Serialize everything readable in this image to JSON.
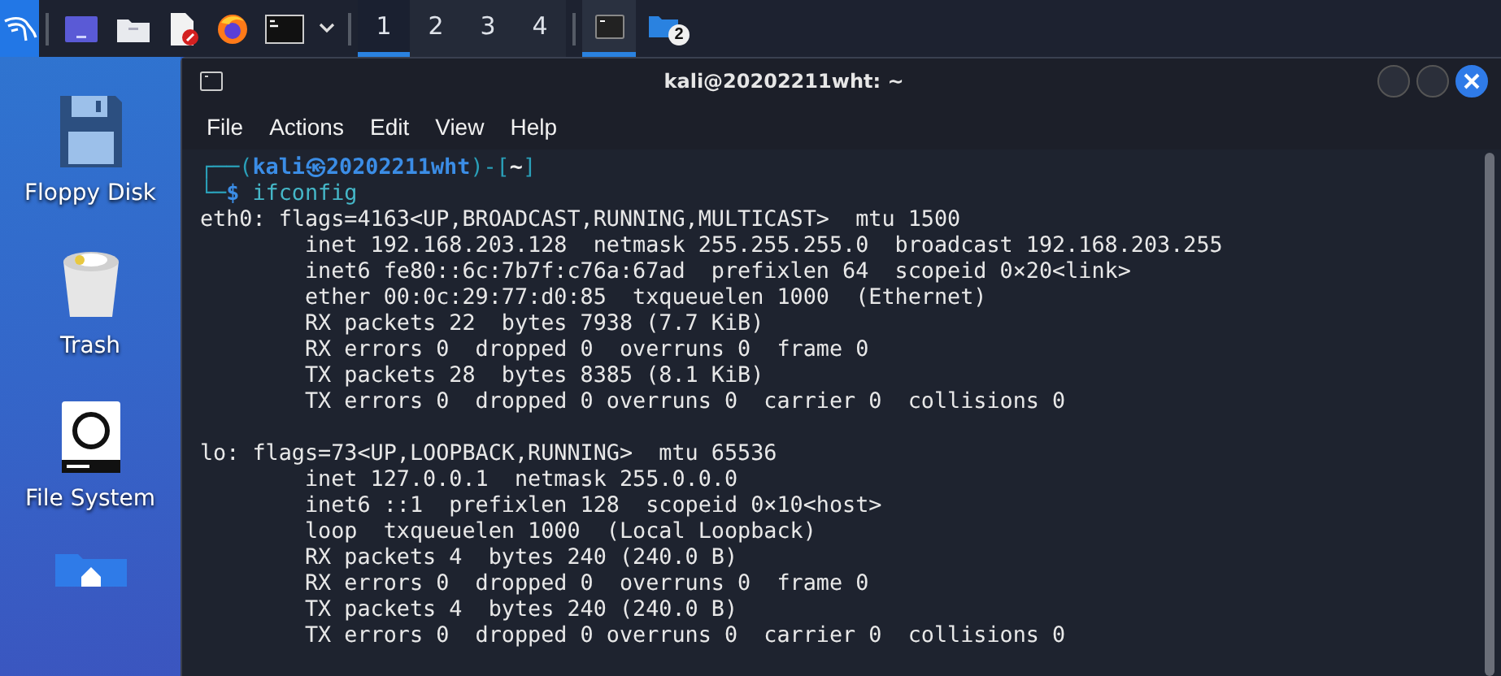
{
  "taskbar": {
    "launchers": [
      {
        "kind": "kali"
      },
      {
        "kind": "desktop"
      },
      {
        "kind": "files"
      },
      {
        "kind": "editor"
      },
      {
        "kind": "firefox"
      },
      {
        "kind": "terminal"
      },
      {
        "kind": "caret"
      }
    ],
    "workspaces": [
      {
        "label": "1",
        "selected": true
      },
      {
        "label": "2",
        "selected": false
      },
      {
        "label": "3",
        "selected": false
      },
      {
        "label": "4",
        "selected": false
      }
    ],
    "tasks": [
      {
        "kind": "terminal",
        "selected": true
      },
      {
        "kind": "folder",
        "selected": false,
        "badge": "2"
      }
    ]
  },
  "desktop": {
    "icons": [
      {
        "kind": "floppy",
        "label": "Floppy Disk"
      },
      {
        "kind": "trash",
        "label": "Trash"
      },
      {
        "kind": "drive",
        "label": "File System"
      },
      {
        "kind": "home"
      }
    ]
  },
  "window": {
    "title": "kali@20202211wht: ~",
    "menu": [
      "File",
      "Actions",
      "Edit",
      "View",
      "Help"
    ],
    "prompt": {
      "top_left": "┌──(",
      "user_host": "kali㉿20202211wht",
      "mid": ")-[",
      "dir": "~",
      "end": "]",
      "bottom_left": "└─",
      "symbol": "$",
      "command": "ifconfig"
    },
    "output": [
      {
        "lines": [
          "eth0: flags=4163<UP,BROADCAST,RUNNING,MULTICAST>  mtu 1500",
          "        inet 192.168.203.128  netmask 255.255.255.0  broadcast 192.168.203.255",
          "        inet6 fe80::6c:7b7f:c76a:67ad  prefixlen 64  scopeid 0×20<link>",
          "        ether 00:0c:29:77:d0:85  txqueuelen 1000  (Ethernet)",
          "        RX packets 22  bytes 7938 (7.7 KiB)",
          "        RX errors 0  dropped 0  overruns 0  frame 0",
          "        TX packets 28  bytes 8385 (8.1 KiB)",
          "        TX errors 0  dropped 0 overruns 0  carrier 0  collisions 0"
        ]
      },
      {
        "lines": [
          "lo: flags=73<UP,LOOPBACK,RUNNING>  mtu 65536",
          "        inet 127.0.0.1  netmask 255.0.0.0",
          "        inet6 ::1  prefixlen 128  scopeid 0×10<host>",
          "        loop  txqueuelen 1000  (Local Loopback)",
          "        RX packets 4  bytes 240 (240.0 B)",
          "        RX errors 0  dropped 0  overruns 0  frame 0",
          "        TX packets 4  bytes 240 (240.0 B)",
          "        TX errors 0  dropped 0 overruns 0  carrier 0  collisions 0"
        ]
      }
    ]
  }
}
